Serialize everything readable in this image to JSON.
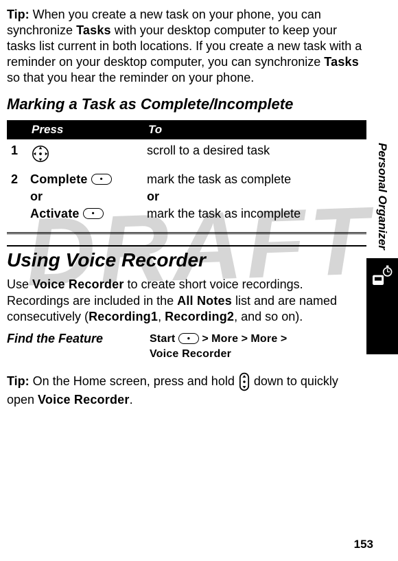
{
  "watermark": "DRAFT",
  "side_label": "Personal Organizer",
  "page_number": "153",
  "tip1": {
    "prefix": "Tip:",
    "part1": " When you create a new task on your phone, you can synchronize ",
    "tasks1": "Tasks",
    "part2": " with your desktop computer to keep your tasks list current in both locations. If you create a new task with a reminder on your desktop computer, you can synchronize ",
    "tasks2": "Tasks",
    "part3": " so that you hear the reminder on your phone."
  },
  "subhead1": "Marking a Task as Complete/Incomplete",
  "table": {
    "press": "Press",
    "to": "To",
    "row1_num": "1",
    "row1_to": "scroll to a desired task",
    "row2_num": "2",
    "row2_complete": "Complete",
    "row2_or": "or",
    "row2_activate": "Activate",
    "row2_to_a": "mark the task as complete",
    "row2_to_or": "or",
    "row2_to_b": "mark the task as incomplete"
  },
  "h1": "Using Voice Recorder",
  "body1": {
    "part1": "Use ",
    "vr": "Voice Recorder",
    "part2": " to create short voice recordings. Recordings are included in the ",
    "allnotes": "All Notes",
    "part3": " list and are named consecutively (",
    "rec1": "Recording1",
    "comma": ", ",
    "rec2": "Recording2",
    "part4": ", and so on)."
  },
  "feature": {
    "label": "Find the Feature",
    "start": "Start",
    "more1": "More",
    "more2": "More",
    "vr": "Voice Recorder",
    "gt": " > "
  },
  "tip2": {
    "prefix": "Tip:",
    "part1": " On the Home screen, press and hold ",
    "part2": " down to quickly open ",
    "vr": "Voice Recorder",
    "period": "."
  }
}
